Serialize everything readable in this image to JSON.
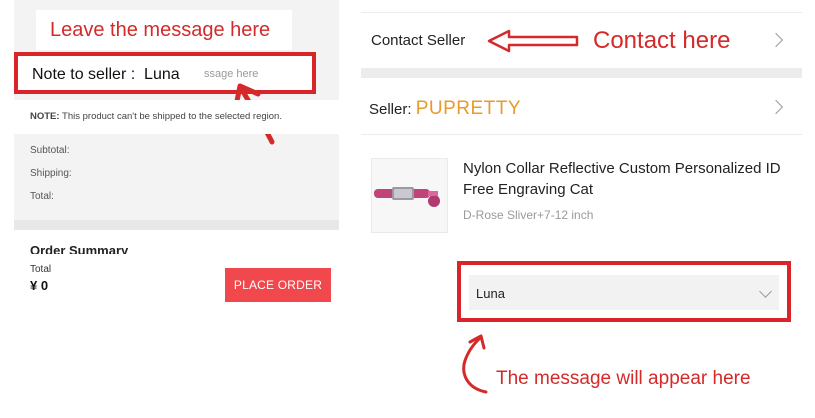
{
  "left": {
    "annotation": "Leave the message here",
    "note_text": "Note to seller :  Luna",
    "note_placeholder_tail": "ssage here",
    "notice_bold": "NOTE:",
    "notice_text": " This product can't be shipped to the selected region.",
    "summary": {
      "subtotal_label": "Subtotal:",
      "shipping_label": "Shipping:",
      "total_label": "Total:"
    },
    "order_summary_title": "Order Summary",
    "footer": {
      "total_label": "Total",
      "total_value": "¥ 0",
      "place_order_label": "PLACE ORDER",
      "button_color": "#f0484d"
    }
  },
  "right": {
    "contact_label": "Contact Seller",
    "contact_annotation": "Contact here",
    "seller_prefix": "Seller: ",
    "seller_name": "PUPRETTY",
    "product": {
      "title": "Nylon Collar Reflective Custom Personalized ID Free Engraving Cat",
      "variant": "D-Rose Sliver+7-12 inch",
      "thumb_icon": "pink-collar-icon"
    },
    "message_value": "Luna",
    "appear_annotation": "The message will appear here"
  },
  "colors": {
    "annotation_red": "#d42a2a",
    "highlight_border": "#d9252a",
    "seller_name": "#e89a2a"
  }
}
